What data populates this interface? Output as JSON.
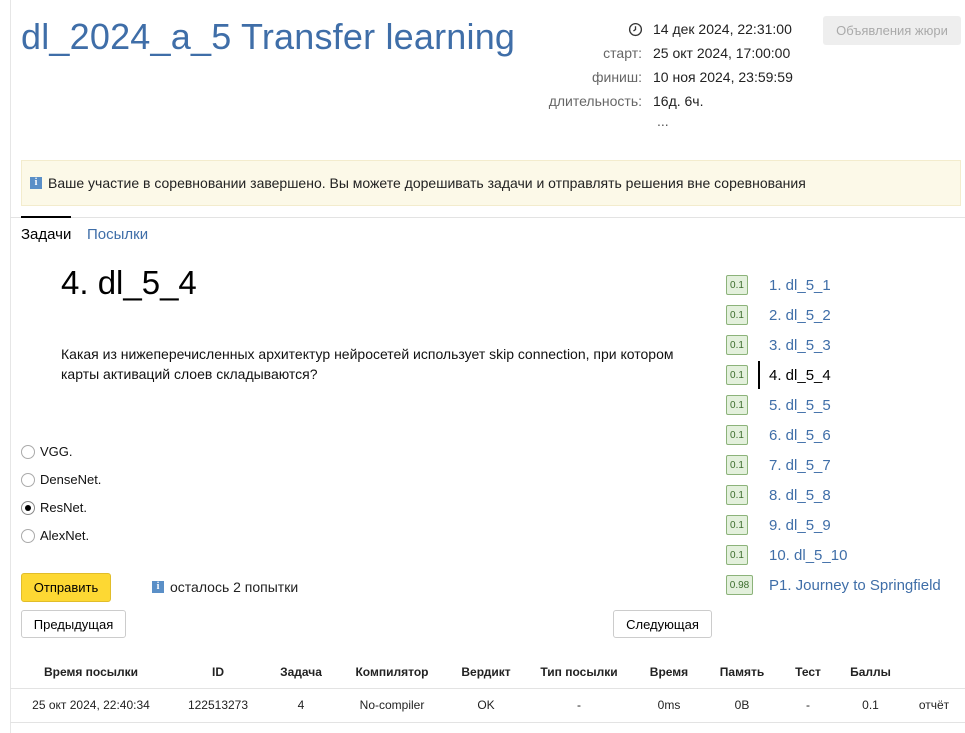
{
  "contest": {
    "title": "dl_2024_a_5 Transfer learning",
    "current_time": "14 дек 2024, 22:31:00",
    "start_label": "старт:",
    "start_value": "25 окт 2024, 17:00:00",
    "finish_label": "финиш:",
    "finish_value": "10 ноя 2024, 23:59:59",
    "duration_label": "длительность:",
    "duration_value": "16д. 6ч.",
    "more": "...",
    "jury_button": "Объявления жюри"
  },
  "notice": {
    "icon": "i",
    "text": "Ваше участие в соревновании завершено. Вы можете дорешивать задачи и отправлять решения вне соревнования"
  },
  "tabs": {
    "problems": "Задачи",
    "submissions": "Посылки"
  },
  "problem": {
    "title": "4. dl_5_4",
    "text": "Какая из нижеперечисленных архитектур нейросетей использует skip connection, при котором карты активаций слоев складываются?",
    "options": [
      {
        "label": "VGG.",
        "checked": false
      },
      {
        "label": "DenseNet.",
        "checked": false
      },
      {
        "label": "ResNet.",
        "checked": true
      },
      {
        "label": "AlexNet.",
        "checked": false
      }
    ],
    "submit_button": "Отправить",
    "attempts_icon": "i",
    "attempts_text": "осталось 2 попытки",
    "prev_button": "Предыдущая",
    "next_button": "Следующая"
  },
  "problem_list": [
    {
      "score": "0.1",
      "label": "1. dl_5_1",
      "current": false
    },
    {
      "score": "0.1",
      "label": "2. dl_5_2",
      "current": false
    },
    {
      "score": "0.1",
      "label": "3. dl_5_3",
      "current": false
    },
    {
      "score": "0.1",
      "label": "4. dl_5_4",
      "current": true
    },
    {
      "score": "0.1",
      "label": "5. dl_5_5",
      "current": false
    },
    {
      "score": "0.1",
      "label": "6. dl_5_6",
      "current": false
    },
    {
      "score": "0.1",
      "label": "7. dl_5_7",
      "current": false
    },
    {
      "score": "0.1",
      "label": "8. dl_5_8",
      "current": false
    },
    {
      "score": "0.1",
      "label": "9. dl_5_9",
      "current": false
    },
    {
      "score": "0.1",
      "label": "10. dl_5_10",
      "current": false
    },
    {
      "score": "0.98",
      "label": "P1. Journey to Springfield",
      "current": false
    }
  ],
  "submissions": {
    "headers": [
      "Время посылки",
      "ID",
      "Задача",
      "Компилятор",
      "Вердикт",
      "Тип посылки",
      "Время",
      "Память",
      "Тест",
      "Баллы",
      ""
    ],
    "rows": [
      [
        "25 окт 2024, 22:40:34",
        "122513273",
        "4",
        "No-compiler",
        "OK",
        "-",
        "0ms",
        "0B",
        "-",
        "0.1",
        "отчёт"
      ]
    ]
  },
  "colors": {
    "link": "#3f6ea8",
    "accent_button": "#fdd833",
    "verdict_ok": "#2e8b2e",
    "notice_bg": "#fcf9e8",
    "score_badge_bg": "#e3f0dc"
  }
}
